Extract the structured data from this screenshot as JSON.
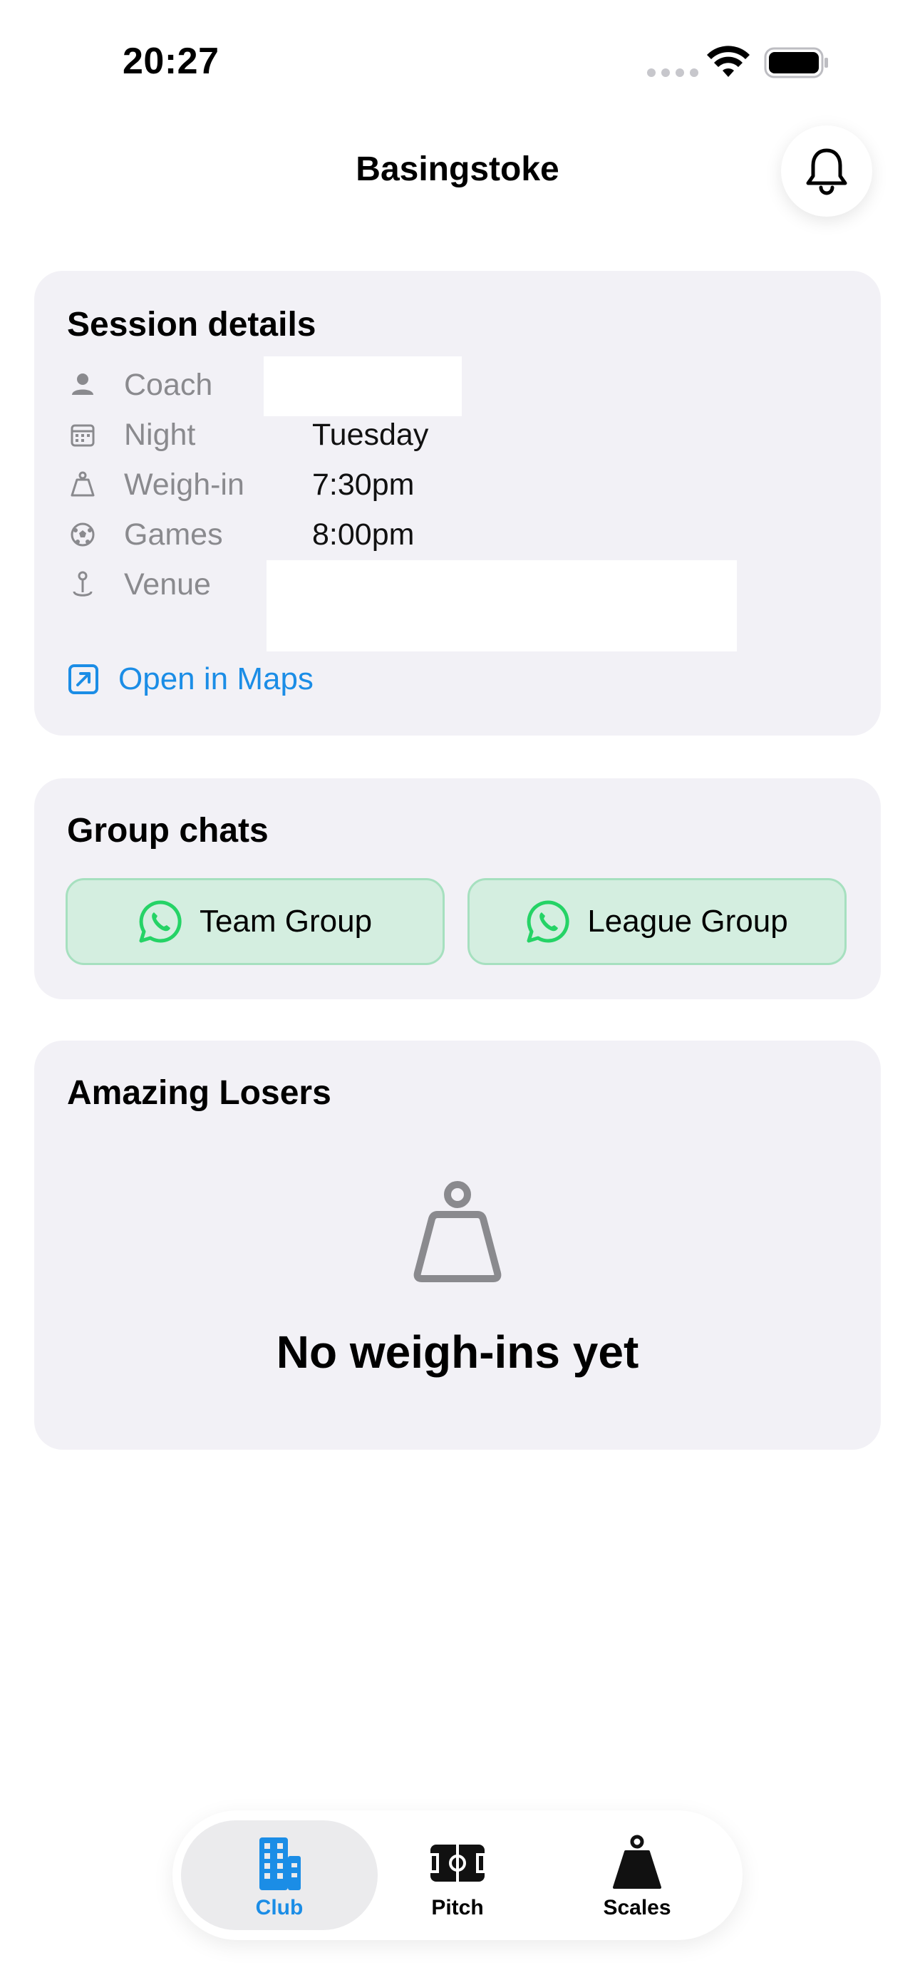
{
  "status_bar": {
    "time": "20:27"
  },
  "header": {
    "title": "Basingstoke",
    "bell_icon": "bell-icon"
  },
  "session_details": {
    "title": "Session details",
    "rows": [
      {
        "icon": "person-icon",
        "label": "Coach",
        "value": ""
      },
      {
        "icon": "calendar-icon",
        "label": "Night",
        "value": "Tuesday"
      },
      {
        "icon": "scale-weight-icon",
        "label": "Weigh-in",
        "value": "7:30pm"
      },
      {
        "icon": "soccer-ball-icon",
        "label": "Games",
        "value": "8:00pm"
      },
      {
        "icon": "map-pin-icon",
        "label": "Venue",
        "value": ""
      }
    ],
    "open_maps_label": "Open in Maps"
  },
  "group_chats": {
    "title": "Group chats",
    "team_label": "Team Group",
    "league_label": "League Group"
  },
  "amazing_losers": {
    "title": "Amazing Losers",
    "empty_text": "No weigh-ins yet"
  },
  "tab_bar": {
    "tabs": [
      {
        "label": "Club",
        "active": true
      },
      {
        "label": "Pitch",
        "active": false
      },
      {
        "label": "Scales",
        "active": false
      }
    ]
  },
  "colors": {
    "accent": "#1b8de6",
    "whatsapp": "#25d366",
    "card_bg": "#f2f1f6"
  }
}
